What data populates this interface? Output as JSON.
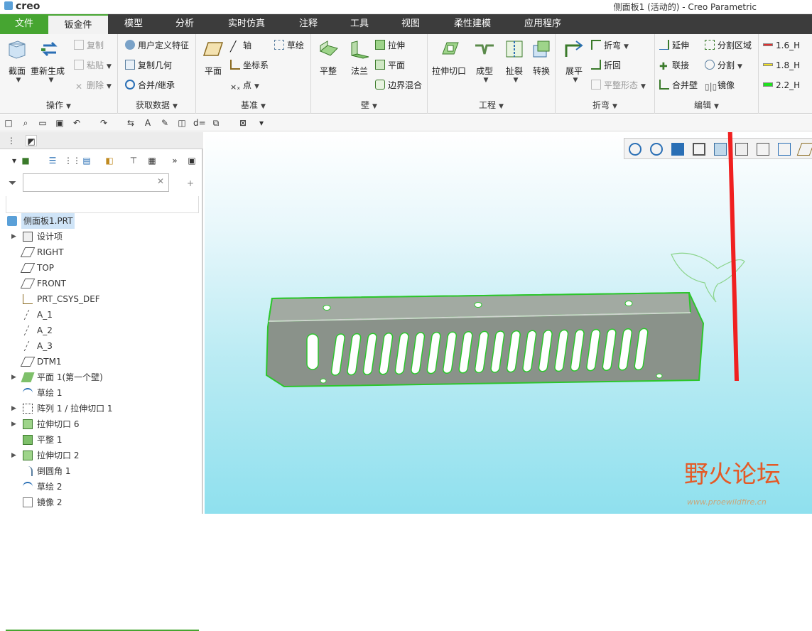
{
  "title_bar": {
    "logo": "creo",
    "window_title": "侧面板1 (活动的) - Creo Parametric"
  },
  "tabs": [
    {
      "label": "文件",
      "active": false
    },
    {
      "label": "钣金件",
      "active": true
    },
    {
      "label": "模型",
      "active": false
    },
    {
      "label": "分析",
      "active": false
    },
    {
      "label": "实时仿真",
      "active": false
    },
    {
      "label": "注释",
      "active": false
    },
    {
      "label": "工具",
      "active": false
    },
    {
      "label": "视图",
      "active": false
    },
    {
      "label": "柔性建模",
      "active": false
    },
    {
      "label": "应用程序",
      "active": false
    }
  ],
  "ribbon": {
    "operations": {
      "label": "操作",
      "cut": "截面",
      "regenerate": "重新生成",
      "copy": "复制",
      "paste": "粘贴",
      "delete": "删除"
    },
    "get_data": {
      "label": "获取数据",
      "udf": "用户定义特征",
      "copy_geom": "复制几何",
      "merge": "合并/继承"
    },
    "datum": {
      "label": "基准",
      "plane": "平面",
      "axis": "轴",
      "csys": "坐标系",
      "point": "点",
      "sketch": "草绘"
    },
    "wall": {
      "label": "壁",
      "flat": "平整",
      "flange": "法兰",
      "extrude": "拉伸",
      "planar": "平面",
      "blend": "边界混合"
    },
    "engineering": {
      "label": "工程",
      "extrude_cut": "拉伸切口",
      "form": "成型",
      "rip": "扯裂",
      "convert": "转换"
    },
    "bend": {
      "label": "折弯",
      "unbend": "展平",
      "bend": "折弯",
      "bend_back": "折回",
      "flat_state": "平整形态"
    },
    "edit": {
      "label": "编辑",
      "extend": "延伸",
      "split_region": "分割区域",
      "join": "联接",
      "split": "分割",
      "merge_wall": "合并壁",
      "mirror": "镜像"
    },
    "thickness": [
      "1.6_H",
      "1.8_H",
      "2.2_H"
    ],
    "thickness_colors": [
      "#e03030",
      "#f0e020",
      "#20e020"
    ]
  },
  "model_tree": {
    "root": "侧面板1.PRT",
    "items": [
      {
        "label": "设计项",
        "icon": "design-items-icon",
        "expand": true
      },
      {
        "label": "RIGHT",
        "icon": "datum-plane-icon",
        "expand": false
      },
      {
        "label": "TOP",
        "icon": "datum-plane-icon",
        "expand": false
      },
      {
        "label": "FRONT",
        "icon": "datum-plane-icon",
        "expand": false
      },
      {
        "label": "PRT_CSYS_DEF",
        "icon": "csys-icon",
        "expand": false
      },
      {
        "label": "A_1",
        "icon": "axis-icon",
        "expand": false
      },
      {
        "label": "A_2",
        "icon": "axis-icon",
        "expand": false
      },
      {
        "label": "A_3",
        "icon": "axis-icon",
        "expand": false
      },
      {
        "label": "DTM1",
        "icon": "datum-plane-icon",
        "expand": false
      },
      {
        "label": "平面 1(第一个壁)",
        "icon": "flat-wall-icon",
        "expand": true
      },
      {
        "label": "草绘 1",
        "icon": "sketch-icon",
        "expand": false
      },
      {
        "label": "阵列 1 / 拉伸切口 1",
        "icon": "pattern-icon",
        "expand": true
      },
      {
        "label": "拉伸切口 6",
        "icon": "extrude-cut-icon",
        "expand": true
      },
      {
        "label": "平整 1",
        "icon": "flat-icon",
        "expand": false
      },
      {
        "label": "拉伸切口 2",
        "icon": "extrude-cut-icon",
        "expand": true
      },
      {
        "label": "倒圆角 1",
        "icon": "round-icon",
        "expand": false
      },
      {
        "label": "草绘 2",
        "icon": "sketch-icon",
        "expand": false
      },
      {
        "label": "镜像 2",
        "icon": "mirror-icon",
        "expand": false
      }
    ]
  },
  "watermark": {
    "main": "野火论坛",
    "sub": "www.proewildfire.cn"
  }
}
